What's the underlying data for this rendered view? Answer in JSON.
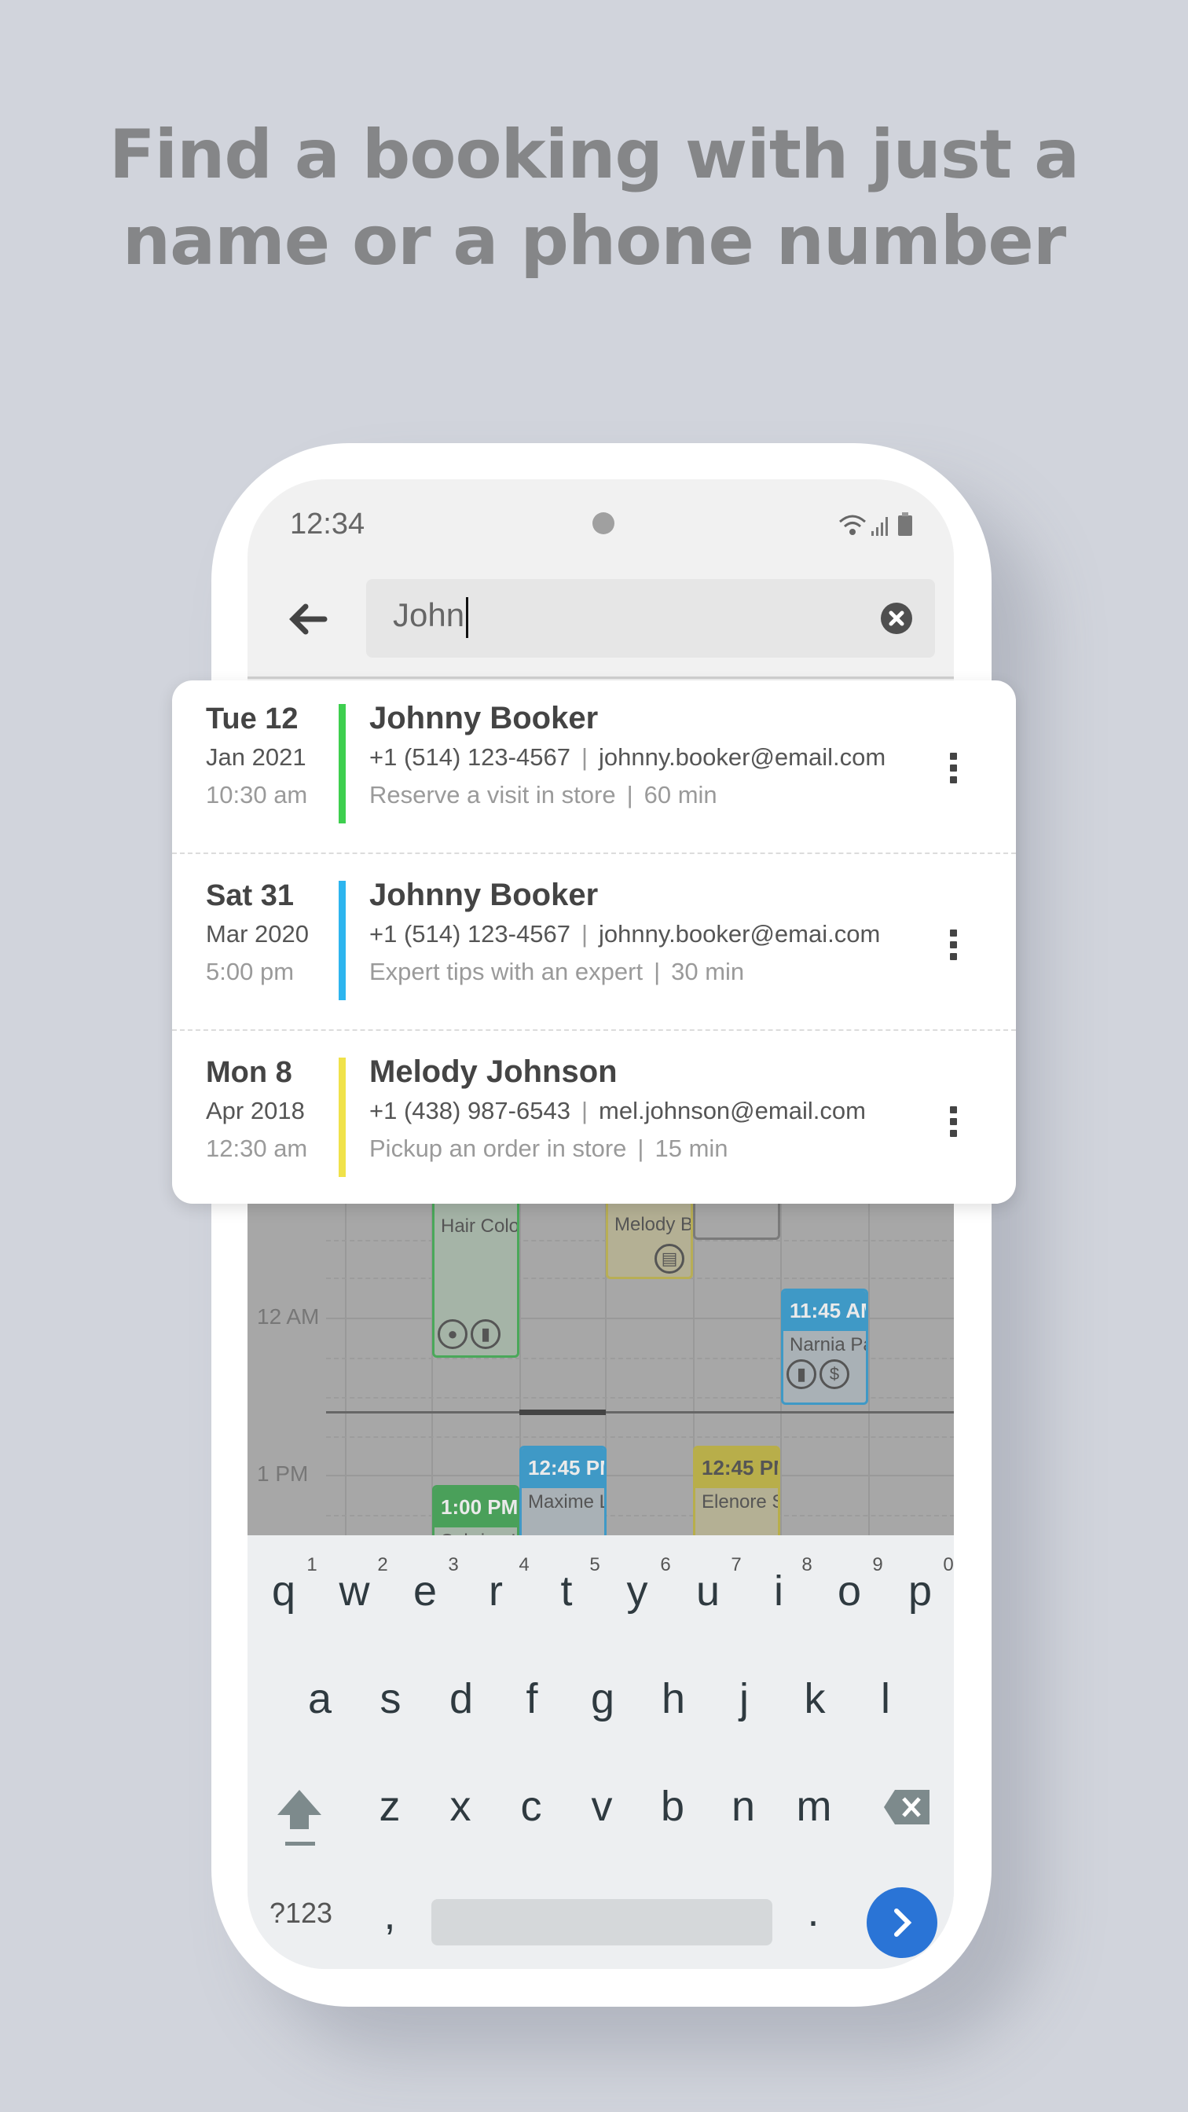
{
  "headline": {
    "line1": "Find a booking with just a",
    "line2": "name or a phone number"
  },
  "status_bar": {
    "time": "12:34",
    "icons": [
      "wifi-icon",
      "signal-icon",
      "battery-icon"
    ]
  },
  "search": {
    "value": "John",
    "back_icon": "arrow-left-icon",
    "clear_icon": "clear-circle-icon"
  },
  "results": [
    {
      "day": "Tue 12",
      "month_year": "Jan 2021",
      "time": "10:30 am",
      "color": "#3ecf4f",
      "name": "Johnny Booker",
      "phone": "+1 (514) 123-4567",
      "email": "johnny.booker@email.com",
      "service": "Reserve a visit in store",
      "duration": "60 min"
    },
    {
      "day": "Sat 31",
      "month_year": "Mar 2020",
      "time": "5:00 pm",
      "color": "#2db5ef",
      "name": "Johnny Booker",
      "phone": "+1 (514) 123-4567",
      "email": "johnny.booker@emai.com",
      "service": "Expert tips with an expert",
      "duration": "30 min"
    },
    {
      "day": "Mon 8",
      "month_year": "Apr 2018",
      "time": "12:30 am",
      "color": "#f0e24a",
      "name": "Melody Johnson",
      "phone": "+1 (438) 987-6543",
      "email": "mel.johnson@email.com",
      "service": "Pickup an order in store",
      "duration": "15 min"
    }
  ],
  "calendar": {
    "time_labels": [
      "12 AM",
      "1 PM"
    ],
    "events": [
      {
        "title": "Hair Colo"
      },
      {
        "title": "Melody B"
      },
      {
        "time": "11:45 AM",
        "title": "Narnia Pa"
      },
      {
        "time": "12:45 PM",
        "title": "Maxime L"
      },
      {
        "time": "1:00 PM",
        "title": "Sabrina H"
      },
      {
        "time": "12:45 PM",
        "title": "Elenore S"
      }
    ]
  },
  "keyboard": {
    "row1": [
      "q",
      "w",
      "e",
      "r",
      "t",
      "y",
      "u",
      "i",
      "o",
      "p"
    ],
    "hints": [
      "1",
      "2",
      "3",
      "4",
      "5",
      "6",
      "7",
      "8",
      "9",
      "0"
    ],
    "row2": [
      "a",
      "s",
      "d",
      "f",
      "g",
      "h",
      "j",
      "k",
      "l"
    ],
    "row3": [
      "z",
      "x",
      "c",
      "v",
      "b",
      "n",
      "m"
    ],
    "symbols": "?123",
    "comma": ",",
    "period": ".",
    "enter_color": "#2a74d6"
  }
}
